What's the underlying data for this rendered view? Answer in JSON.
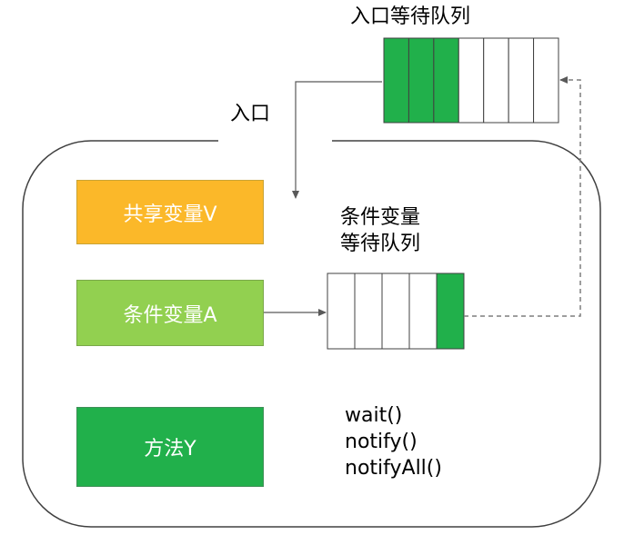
{
  "monitor": {
    "entry_label": "入口",
    "entry_queue_title": "入口等待队列",
    "cond_queue_title_line1": "条件变量",
    "cond_queue_title_line2": "等待队列"
  },
  "boxes": {
    "shared_var": {
      "label": "共享变量V",
      "color": "#fbb829"
    },
    "cond_var": {
      "label": "条件变量A",
      "color": "#92d050"
    },
    "method": {
      "label": "方法Y",
      "color": "#21b04b"
    }
  },
  "methods": [
    "wait()",
    "notify()",
    "notifyAll()"
  ],
  "entry_queue": {
    "slots": [
      1,
      1,
      1,
      0,
      0,
      0,
      0
    ],
    "fill_color": "#21b04b"
  },
  "cond_queue": {
    "slots": [
      0,
      0,
      0,
      0,
      1
    ],
    "fill_color": "#21b04b"
  },
  "colors": {
    "line": "#595959",
    "dashed": "#7f7f7f",
    "border": "#404040"
  }
}
